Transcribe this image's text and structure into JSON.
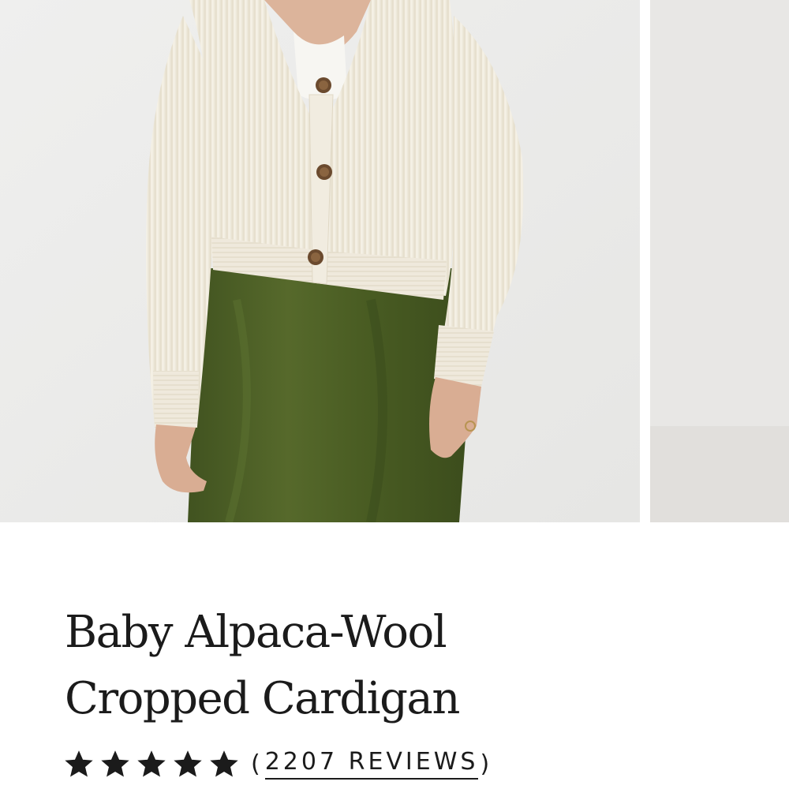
{
  "product": {
    "title": "Baby Alpaca-Wool Cropped Cardigan"
  },
  "gallery": {
    "images": [
      {
        "name": "model-wearing-cream-cardigan-green-skirt",
        "icon": "product-photo"
      },
      {
        "name": "next-product-photo-partial",
        "icon": "product-photo"
      }
    ]
  },
  "rating": {
    "stars": 5,
    "max_stars": 5,
    "open_paren": "(",
    "reviews_label": "2207 REVIEWS",
    "close_paren": ")"
  },
  "colors": {
    "text": "#1b1b1b",
    "cardigan": "#f3efe4",
    "skirt": "#4a5d23",
    "background": "#ececeb",
    "button": "#6b4a2e"
  }
}
